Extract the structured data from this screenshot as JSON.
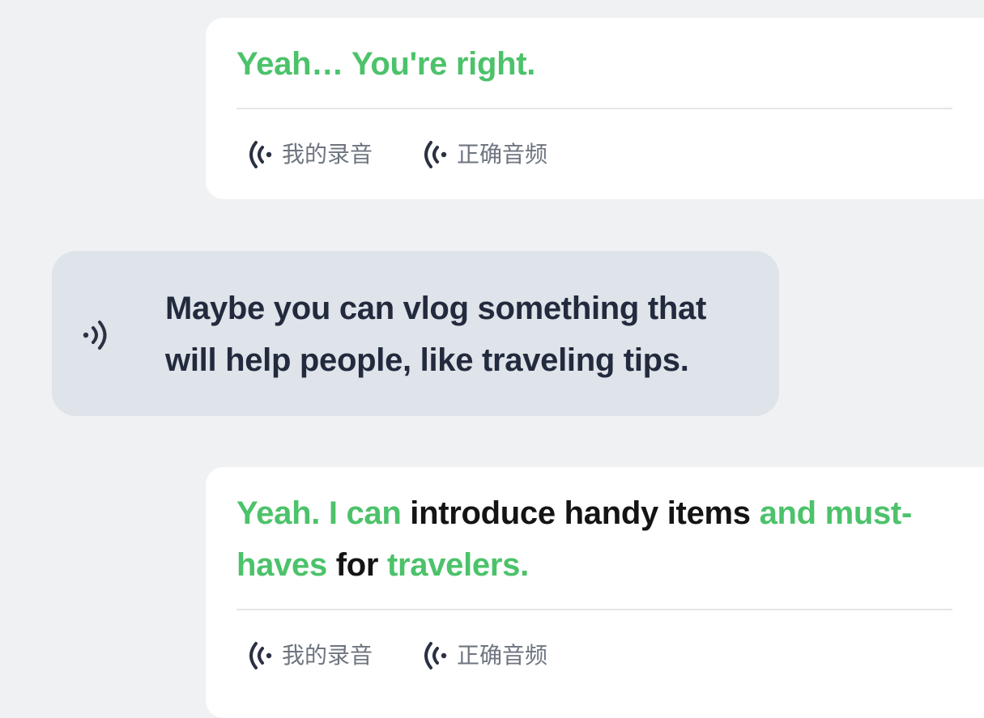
{
  "messages": [
    {
      "role": "user",
      "segments": [
        {
          "text": "Yeah… You're right.",
          "status": "correct"
        }
      ],
      "actions": {
        "my_recording": "我的录音",
        "correct_audio": "正确音频"
      }
    },
    {
      "role": "partner",
      "text": "Maybe you can vlog something that will help people, like traveling tips."
    },
    {
      "role": "user",
      "segments": [
        {
          "text": "Yeah. I can ",
          "status": "correct"
        },
        {
          "text": "introduce handy items ",
          "status": "incorrect"
        },
        {
          "text": "and must-haves ",
          "status": "correct"
        },
        {
          "text": "for ",
          "status": "incorrect"
        },
        {
          "text": "travelers.",
          "status": "correct"
        }
      ],
      "actions": {
        "my_recording": "我的录音",
        "correct_audio": "正确音频"
      }
    }
  ],
  "icons": {
    "recording": "sound-wave-icon",
    "partner_play": "speaker-icon"
  },
  "colors": {
    "correct": "#4cc26a",
    "incorrect": "#141414",
    "background": "#f0f1f3",
    "partner_bubble": "#dfe3ea",
    "partner_text": "#222b3d",
    "action_label": "#6e7580",
    "icon": "#2a3142"
  }
}
